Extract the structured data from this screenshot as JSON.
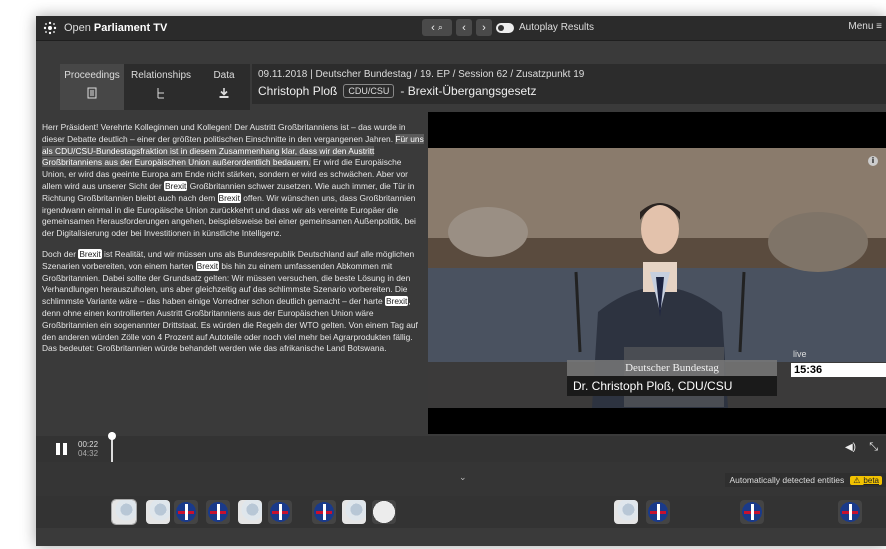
{
  "app": {
    "brand_light": "Open",
    "brand_bold": "Parliament TV",
    "autoplay_label": "Autoplay Results",
    "menu_label": "Menu ≡"
  },
  "nav": {
    "search_glyph": "🔍",
    "prev": "‹",
    "next": "›"
  },
  "tabs": [
    {
      "label": "Proceedings",
      "icon": "document-icon",
      "active": true
    },
    {
      "label": "Relationships",
      "icon": "hierarchy-icon",
      "active": false
    },
    {
      "label": "Data",
      "icon": "download-icon",
      "active": false
    }
  ],
  "header": {
    "meta": "09.11.2018 | Deutscher Bundestag / 19. EP / Session 62 / Zusatzpunkt 19",
    "speaker": "Christoph Ploß",
    "party": "CDU/CSU",
    "topic": "- Brexit-Übergangsgesetz"
  },
  "transcript": {
    "p1": [
      {
        "t": "Herr Präsident! Verehrte Kolleginnen und Kollegen! Der Austritt Großbritanniens ist – das wurde in dieser Debatte deutlich – einer der größten politischen Einschnitte in den vergangenen Jahren. "
      },
      {
        "t": "Für uns als CDU/CSU-Bundestagsfraktion ist in diesem Zusammenhang klar, dass wir den Austritt Großbritanniens aus der Europäischen Union außerordentlich bedauern.",
        "c": "hl"
      },
      {
        "t": " Er wird die Europäische Union, er wird das geeinte Europa am Ende nicht stärken, sondern er wird es schwächen. Aber vor allem wird aus unserer Sicht der "
      },
      {
        "t": "Brexit",
        "c": "ent"
      },
      {
        "t": " Großbritannien schwer zusetzen. Wie auch immer, die Tür in Richtung Großbritannien bleibt auch nach dem "
      },
      {
        "t": "Brexit",
        "c": "ent"
      },
      {
        "t": " offen. Wir wünschen uns, dass Großbritannien irgendwann einmal in die Europäische Union zurückkehrt und dass wir als vereinte Europäer die gemeinsamen Herausforderungen angehen, beispielsweise bei einer gemeinsamen Außenpolitik, bei der Digitalisierung oder bei Investitionen in künstliche Intelligenz."
      }
    ],
    "p2": [
      {
        "t": "Doch der "
      },
      {
        "t": "Brexit",
        "c": "ent"
      },
      {
        "t": " ist Realität, und wir müssen uns als Bundesrepublik Deutschland auf alle möglichen Szenarien vorbereiten, von einem harten "
      },
      {
        "t": "Brexit",
        "c": "ent"
      },
      {
        "t": " bis hin zu einem umfassenden Abkommen mit Großbritannien. Dabei sollte der Grundsatz gelten: Wir müssen versuchen, die beste Lösung in den Verhandlungen herauszuholen, uns aber gleichzeitig auf das schlimmste Szenario vorbereiten. Die schlimmste Variante wäre – das haben einige Vorredner schon deutlich gemacht – der harte "
      },
      {
        "t": "Brexit",
        "c": "ent"
      },
      {
        "t": ", denn ohne einen kontrollierten Austritt Großbritanniens aus der Europäischen Union wäre Großbritannien ein sogenannter Drittstaat. Es würden die Regeln der WTO gelten. Von einem Tag auf den anderen würden Zölle von 4 Prozent auf Autoteile oder noch viel mehr bei Agrarprodukten fällig. Das bedeutet: Großbritannien würde behandelt werden wie das afrikanische Land Botswana."
      }
    ]
  },
  "video": {
    "banner_top": "Deutscher Bundestag",
    "banner_name": "Dr. Christoph Ploß, CDU/CSU",
    "live_label": "live",
    "clock": "15:36"
  },
  "player": {
    "current": "00:22",
    "total": "04:32",
    "progress": 0.08
  },
  "entities": {
    "label": "Automatically detected entities",
    "beta_label": "beta",
    "thumbs": [
      "globe",
      "globe",
      "flag",
      "flag",
      "globe",
      "flag",
      "flag",
      "globe",
      "circle",
      "globe",
      "flag",
      "flag",
      "flag"
    ]
  },
  "colors": {
    "accent_warning": "#f2c200",
    "background": "#3a3a3a"
  }
}
